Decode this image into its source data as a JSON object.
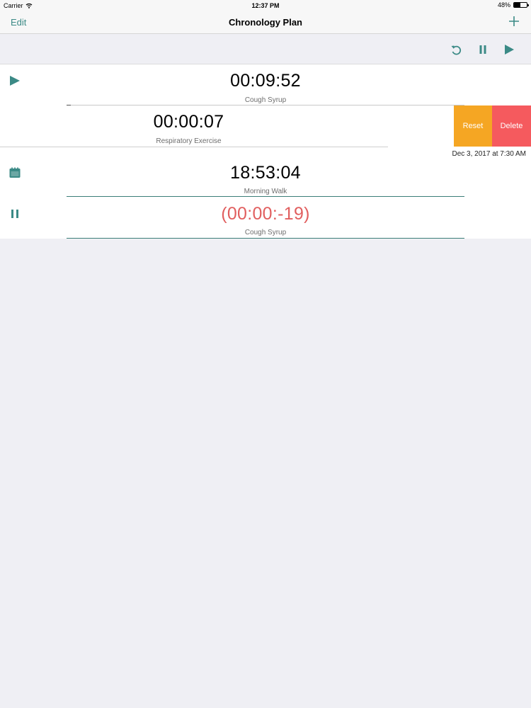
{
  "status_bar": {
    "carrier": "Carrier",
    "time": "12:37 PM",
    "battery": "48%",
    "battery_level": 0.48
  },
  "nav": {
    "edit_label": "Edit",
    "title": "Chronology Plan",
    "add_icon": "plus-icon"
  },
  "toolbar": {
    "icons": [
      "reset-icon",
      "pause-icon",
      "play-icon"
    ]
  },
  "rows": [
    {
      "state_icon": "play-icon",
      "time": "00:09:52",
      "label": "Cough Syrup",
      "progress": 0.01
    },
    {
      "time": "00:00:07",
      "label": "Respiratory Exercise",
      "date": "Dec 3, 2017 at 7:30 AM"
    },
    {
      "state_icon": "calendar-icon",
      "time": "18:53:04",
      "label": "Morning Walk",
      "progress": 1.0
    },
    {
      "state_icon": "pause-icon",
      "time": "(00:00:-19)",
      "label": "Cough Syrup",
      "progress": 1.0
    }
  ],
  "swipe_actions": {
    "reset": "Reset",
    "delete": "Delete"
  },
  "colors": {
    "accent": "#3b8a86",
    "reset": "#f5a623",
    "delete": "#f55a5e",
    "overdue": "#e15f5f"
  }
}
